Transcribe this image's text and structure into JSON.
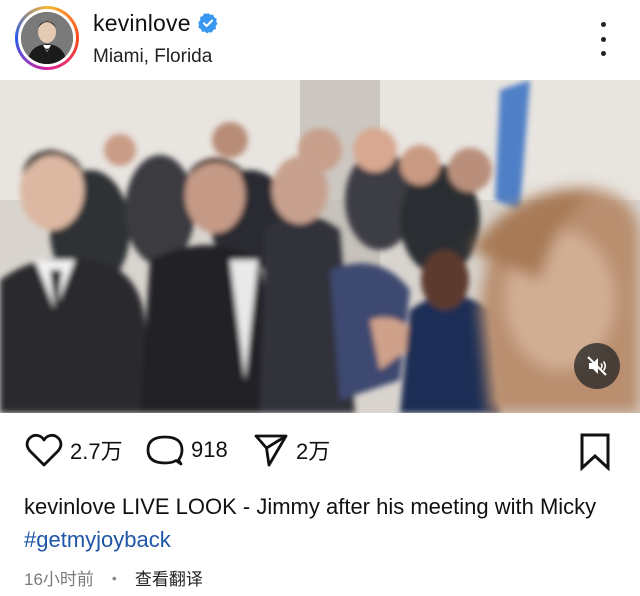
{
  "header": {
    "username": "kevinlove",
    "location": "Miami, Florida"
  },
  "actions": {
    "likes": "2.7万",
    "comments": "918",
    "shares": "2万"
  },
  "caption": {
    "username": "kevinlove",
    "text": "LIVE LOOK - Jimmy after his meeting with Micky",
    "hashtag": "#getmyjoyback"
  },
  "meta": {
    "time_ago": "16小时前",
    "separator": "•",
    "translate": "查看翻译"
  },
  "colors": {
    "verified": "#3897f0",
    "hashtag": "#1f56a8",
    "meta_text": "#7b7b7b"
  },
  "icons": [
    "verified-badge-icon",
    "more-options-icon",
    "mute-icon",
    "heart-icon",
    "comment-icon",
    "share-icon",
    "bookmark-icon"
  ]
}
